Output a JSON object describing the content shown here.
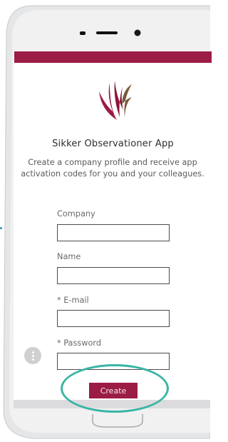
{
  "app": {
    "title": "Sikker Observationer App",
    "description": "Create a company profile and receive app activation codes for you and your colleagues."
  },
  "form": {
    "company_label": "Company",
    "company_value": "",
    "name_label": "Name",
    "name_value": "",
    "email_label": "* E-mail",
    "email_value": "",
    "password_label": "* Password",
    "password_value": "",
    "create_label": "Create"
  },
  "icons": {
    "logo": "sikker-logo",
    "help": "more-vertical-icon"
  },
  "colors": {
    "brand": "#9b1c45",
    "highlight": "#3bb5a5",
    "logo_brown": "#7a5a3c"
  }
}
